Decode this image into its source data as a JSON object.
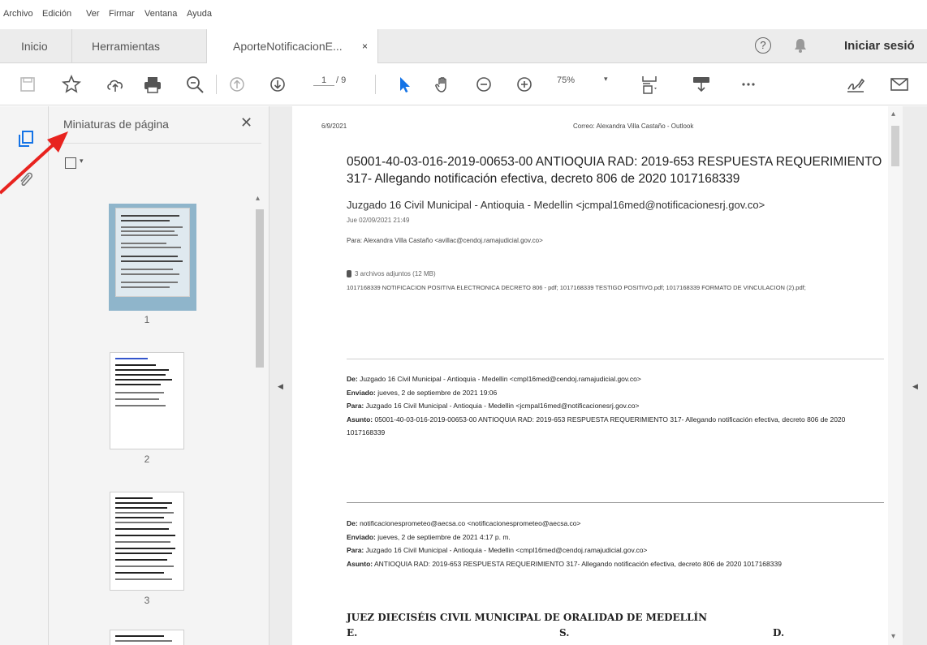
{
  "menu": [
    "Archivo",
    "Edición",
    "Ver",
    "Firmar",
    "Ventana",
    "Ayuda"
  ],
  "tabs": {
    "home": "Inicio",
    "tools": "Herramientas",
    "document": "AporteNotificacionE...",
    "close": "×"
  },
  "header_right": {
    "signin": "Iniciar sesió",
    "help": "?"
  },
  "toolbar": {
    "page_current": "1",
    "page_total": "/ 9",
    "zoom": "75%",
    "zoom_dd": "▾"
  },
  "thumbnails_panel": {
    "title": "Miniaturas de página",
    "close": "✕",
    "pages": [
      "1",
      "2",
      "3"
    ]
  },
  "document": {
    "header_date": "6/9/2021",
    "header_title": "Correo: Alexandra Villa Castaño - Outlook",
    "subject": "05001-40-03-016-2019-00653-00 ANTIOQUIA RAD: 2019-653 RESPUESTA REQUERIMIENTO 317- Allegando notificación efectiva, decreto 806 de 2020 1017168339",
    "from": "Juzgado 16 Civil Municipal - Antioquia - Medellin <jcmpal16med@notificacionesrj.gov.co>",
    "date": "Jue 02/09/2021 21:49",
    "to": "Para:  Alexandra Villa Castaño <avillac@cendoj.ramajudicial.gov.co>",
    "attach_count": "3 archivos adjuntos (12 MB)",
    "attach_files": "1017168339 NOTIFICACION POSITIVA ELECTRONICA DECRETO 806 - pdf; 1017168339 TESTIGO POSITIVO.pdf; 1017168339 FORMATO DE VINCULACION (2).pdf;",
    "msg1": {
      "from_label": "De:",
      "from": " Juzgado 16 Civil Municipal - Antioquia - Medellin <cmpl16med@cendoj.ramajudicial.gov.co>",
      "sent_label": "Enviado:",
      "sent": " jueves, 2 de septiembre de 2021 19:06",
      "to_label": "Para:",
      "to": " Juzgado 16 Civil Municipal - Antioquia - Medellin <jcmpal16med@notificacionesrj.gov.co>",
      "subject_label": "Asunto:",
      "subject": " 05001-40-03-016-2019-00653-00 ANTIOQUIA RAD: 2019-653 RESPUESTA REQUERIMIENTO 317- Allegando notificación efectiva, decreto 806 de 2020 1017168339"
    },
    "msg2": {
      "from_label": "De:",
      "from": " notificacionesprometeo@aecsa.co <notificacionesprometeo@aecsa.co>",
      "sent_label": "Enviado:",
      "sent": " jueves, 2 de septiembre de 2021 4:17 p. m.",
      "to_label": "Para:",
      "to": " Juzgado 16 Civil Municipal - Antioquia - Medellin <cmpl16med@cendoj.ramajudicial.gov.co>",
      "subject_label": "Asunto:",
      "subject": " ANTIOQUIA RAD: 2019-653 RESPUESTA REQUERIMIENTO 317- Allegando notificación efectiva, decreto 806 de 2020 1017168339"
    },
    "judge_line1": "JUEZ DIECISÉIS CIVIL MUNICIPAL DE ORALIDAD DE MEDELLÍN",
    "judge_e": "E.",
    "judge_s": "S.",
    "judge_d": "D."
  },
  "colors": {
    "annotation_arrow": "#e8231f",
    "selection": "#8fb5cb",
    "accent": "#1473e6"
  }
}
